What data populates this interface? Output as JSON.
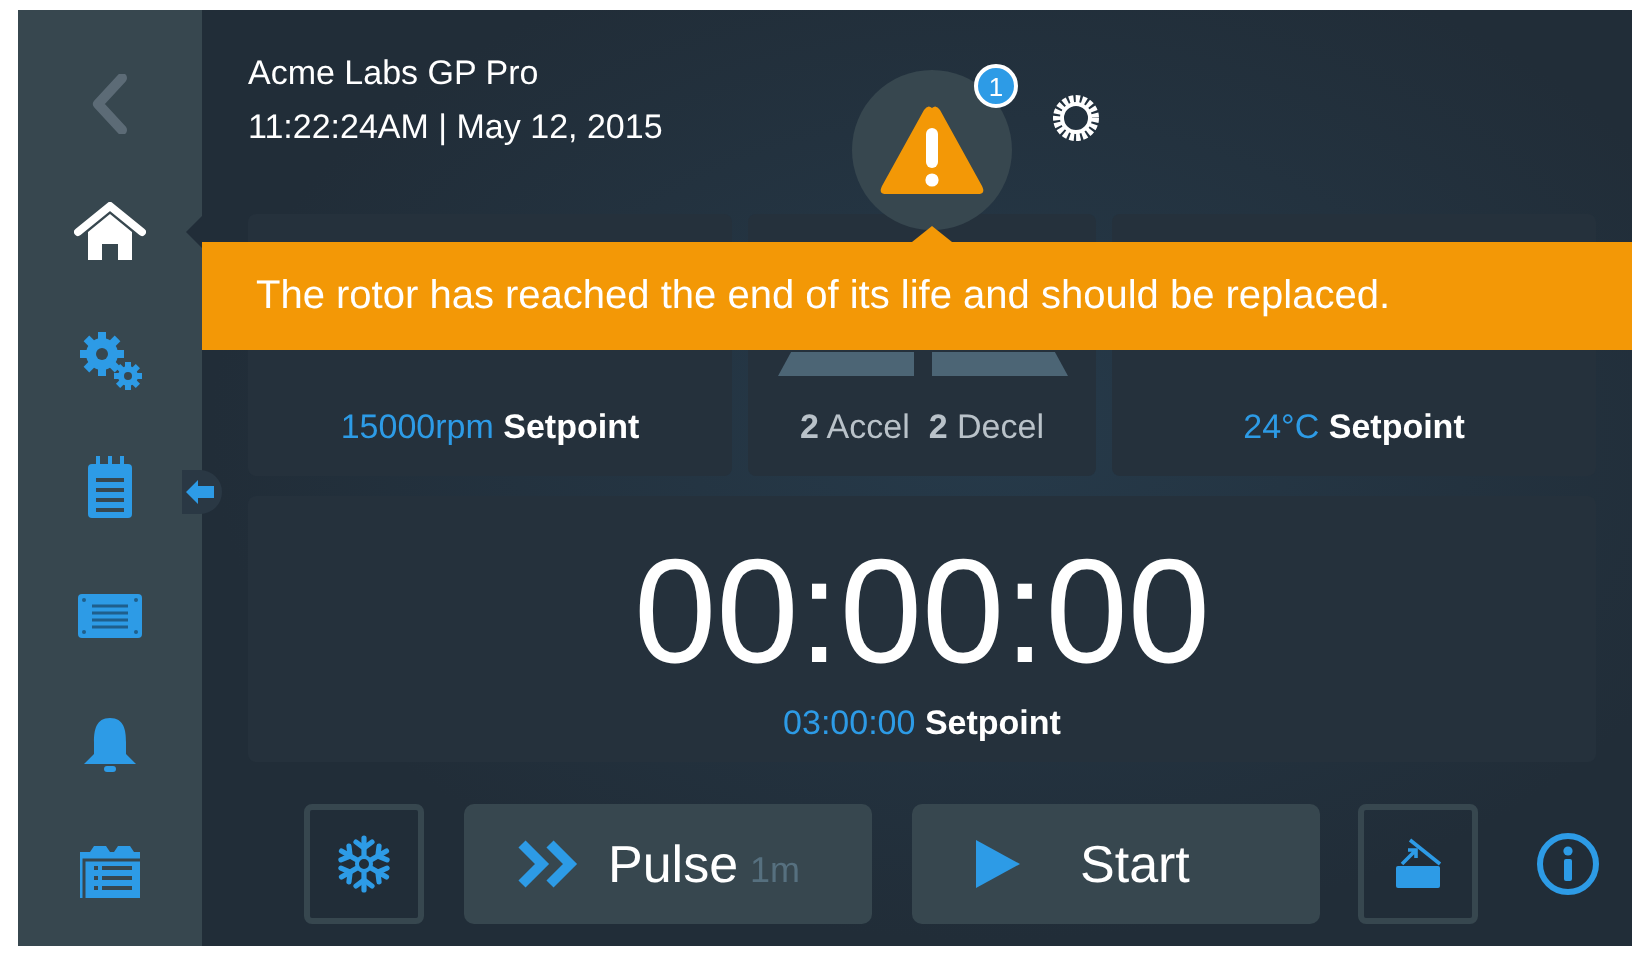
{
  "header": {
    "title": "Acme Labs GP Pro",
    "datetime": "11:22:24AM | May 12, 2015",
    "alert_count": "1"
  },
  "sidebar": {
    "items": [
      {
        "kind": "back",
        "selected": false
      },
      {
        "kind": "home",
        "selected": true
      },
      {
        "kind": "settings",
        "selected": false
      },
      {
        "kind": "clipboard",
        "selected": false
      },
      {
        "kind": "panel",
        "selected": false
      },
      {
        "kind": "bell",
        "selected": false
      },
      {
        "kind": "list",
        "selected": false
      }
    ]
  },
  "alert": {
    "message": "The rotor has reached the end of its life and should be replaced."
  },
  "cards": [
    {
      "kind": "speed",
      "setpoint": "15000rpm",
      "setpoint_label": "Setpoint"
    },
    {
      "kind": "ramp",
      "accel": "2",
      "accel_label": "Accel",
      "decel": "2",
      "decel_label": "Decel"
    },
    {
      "kind": "temperature",
      "setpoint": "24°C",
      "setpoint_label": "Setpoint"
    }
  ],
  "timer": {
    "value": "00:00:00",
    "setpoint": "03:00:00",
    "setpoint_label": "Setpoint"
  },
  "actions": [
    {
      "kind": "cool"
    },
    {
      "kind": "pulse",
      "label": "Pulse",
      "hint": "1m"
    },
    {
      "kind": "start",
      "label": "Start"
    },
    {
      "kind": "lid"
    },
    {
      "kind": "info"
    }
  ]
}
